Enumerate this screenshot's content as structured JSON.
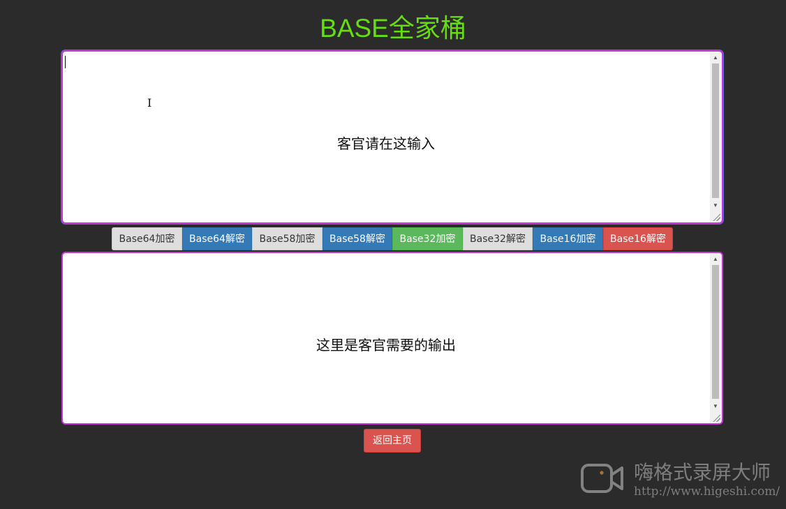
{
  "page": {
    "title": "BASE全家桶"
  },
  "input": {
    "placeholder": "客官请在这输入",
    "value": ""
  },
  "output": {
    "placeholder": "这里是客官需要的输出",
    "value": ""
  },
  "buttons": [
    {
      "label": "Base64加密",
      "style": "default"
    },
    {
      "label": "Base64解密",
      "style": "primary"
    },
    {
      "label": "Base58加密",
      "style": "default"
    },
    {
      "label": "Base58解密",
      "style": "primary"
    },
    {
      "label": "Base32加密",
      "style": "success"
    },
    {
      "label": "Base32解密",
      "style": "default"
    },
    {
      "label": "Base16加密",
      "style": "primary"
    },
    {
      "label": "Base16解密",
      "style": "danger"
    }
  ],
  "back_button": {
    "label": "返回主页"
  },
  "watermark": {
    "name": "嗨格式录屏大师",
    "url": "http://www.higeshi.com/"
  },
  "colors": {
    "background": "#2b2b2b",
    "title": "#66dd11",
    "textarea_border": "#c535d6",
    "default": "#dedede",
    "primary": "#337ab7",
    "success": "#5cb85c",
    "danger": "#d9534f"
  },
  "icons": {
    "cursor": "text-cursor-icon",
    "logo": "camera-logo-icon"
  }
}
